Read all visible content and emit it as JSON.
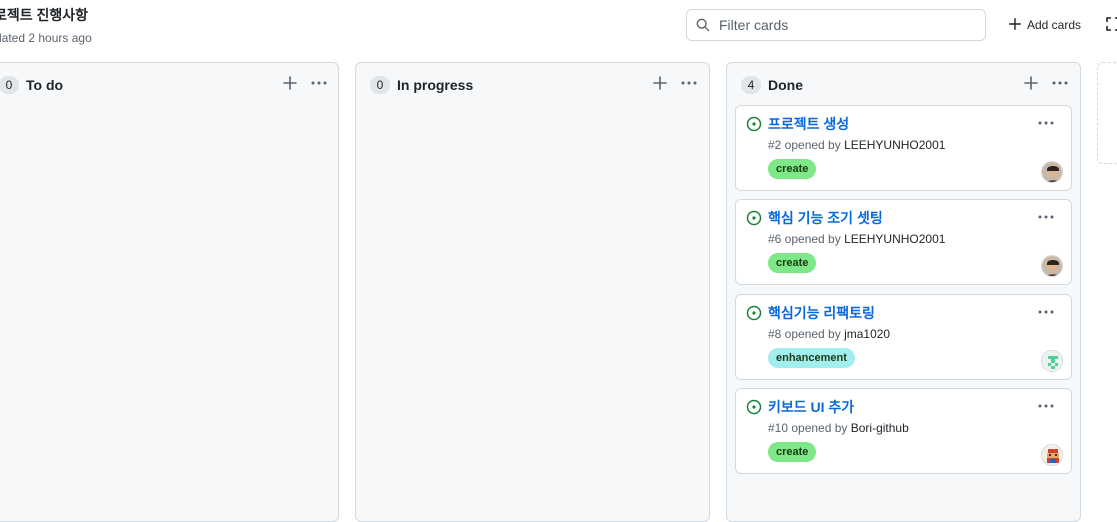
{
  "header": {
    "title": "로젝트 진행사항",
    "subtitle": "dated 2 hours ago",
    "filter_placeholder": "Filter cards",
    "add_cards_label": "Add cards"
  },
  "colors": {
    "green_label": "#7ee787",
    "cyan_label": "#a2eeef",
    "link": "#0969da",
    "open_status": "#1a7f37"
  },
  "columns": [
    {
      "name": "To do",
      "count": "0",
      "cards": []
    },
    {
      "name": "In progress",
      "count": "0",
      "cards": []
    },
    {
      "name": "Done",
      "count": "4",
      "cards": [
        {
          "title": "프로젝트 생성",
          "meta_prefix": "#2 opened by ",
          "user": "LEEHYUNHO2001",
          "label": "create",
          "label_color": "#7ee787",
          "avatar": "user-avatar-photo"
        },
        {
          "title": "핵심 기능 조기 셋팅",
          "meta_prefix": "#6 opened by ",
          "user": "LEEHYUNHO2001",
          "label": "create",
          "label_color": "#7ee787",
          "avatar": "user-avatar-photo"
        },
        {
          "title": "핵심기능 리팩토링",
          "meta_prefix": "#8 opened by ",
          "user": "jma1020",
          "label": "enhancement",
          "label_color": "#a2eeef",
          "avatar": "identicon-avatar"
        },
        {
          "title": "키보드 UI 추가",
          "meta_prefix": "#10 opened by ",
          "user": "Bori-github",
          "label": "create",
          "label_color": "#7ee787",
          "avatar": "pixel-character-avatar"
        }
      ]
    }
  ]
}
